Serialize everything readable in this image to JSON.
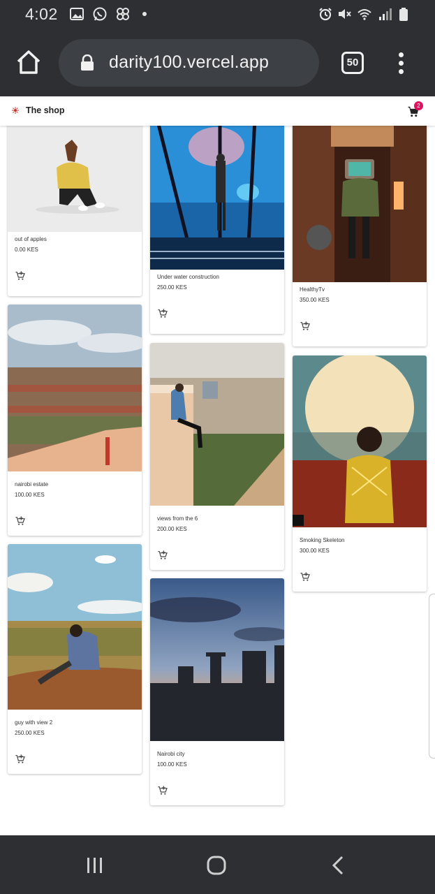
{
  "status_bar": {
    "time": "4:02",
    "icons": [
      "gallery-icon",
      "whatsapp-icon",
      "pinwheel-icon",
      "alarm-icon",
      "mute-icon",
      "wifi-icon",
      "signal-icon",
      "battery-icon"
    ]
  },
  "browser": {
    "url": "darity100.vercel.app",
    "tab_count": "50"
  },
  "app": {
    "title": "The shop",
    "cart_count": "2",
    "accent_color": "#e0115f"
  },
  "products": [
    {
      "title": "out of apples",
      "price": "0.00 KES"
    },
    {
      "title": "Under water construction",
      "price": "250.00 KES"
    },
    {
      "title": "HealthyTv",
      "price": "350.00 KES"
    },
    {
      "title": "nairobi estate",
      "price": "100.00 KES"
    },
    {
      "title": "views from the 6",
      "price": "200.00 KES"
    },
    {
      "title": "Smoking Skeleton",
      "price": "300.00 KES"
    },
    {
      "title": "guy with view 2",
      "price": "250.00 KES"
    },
    {
      "title": "Nairobi city",
      "price": "100.00 KES"
    }
  ],
  "nav": {
    "buttons": [
      "recent-apps",
      "home",
      "back"
    ]
  }
}
